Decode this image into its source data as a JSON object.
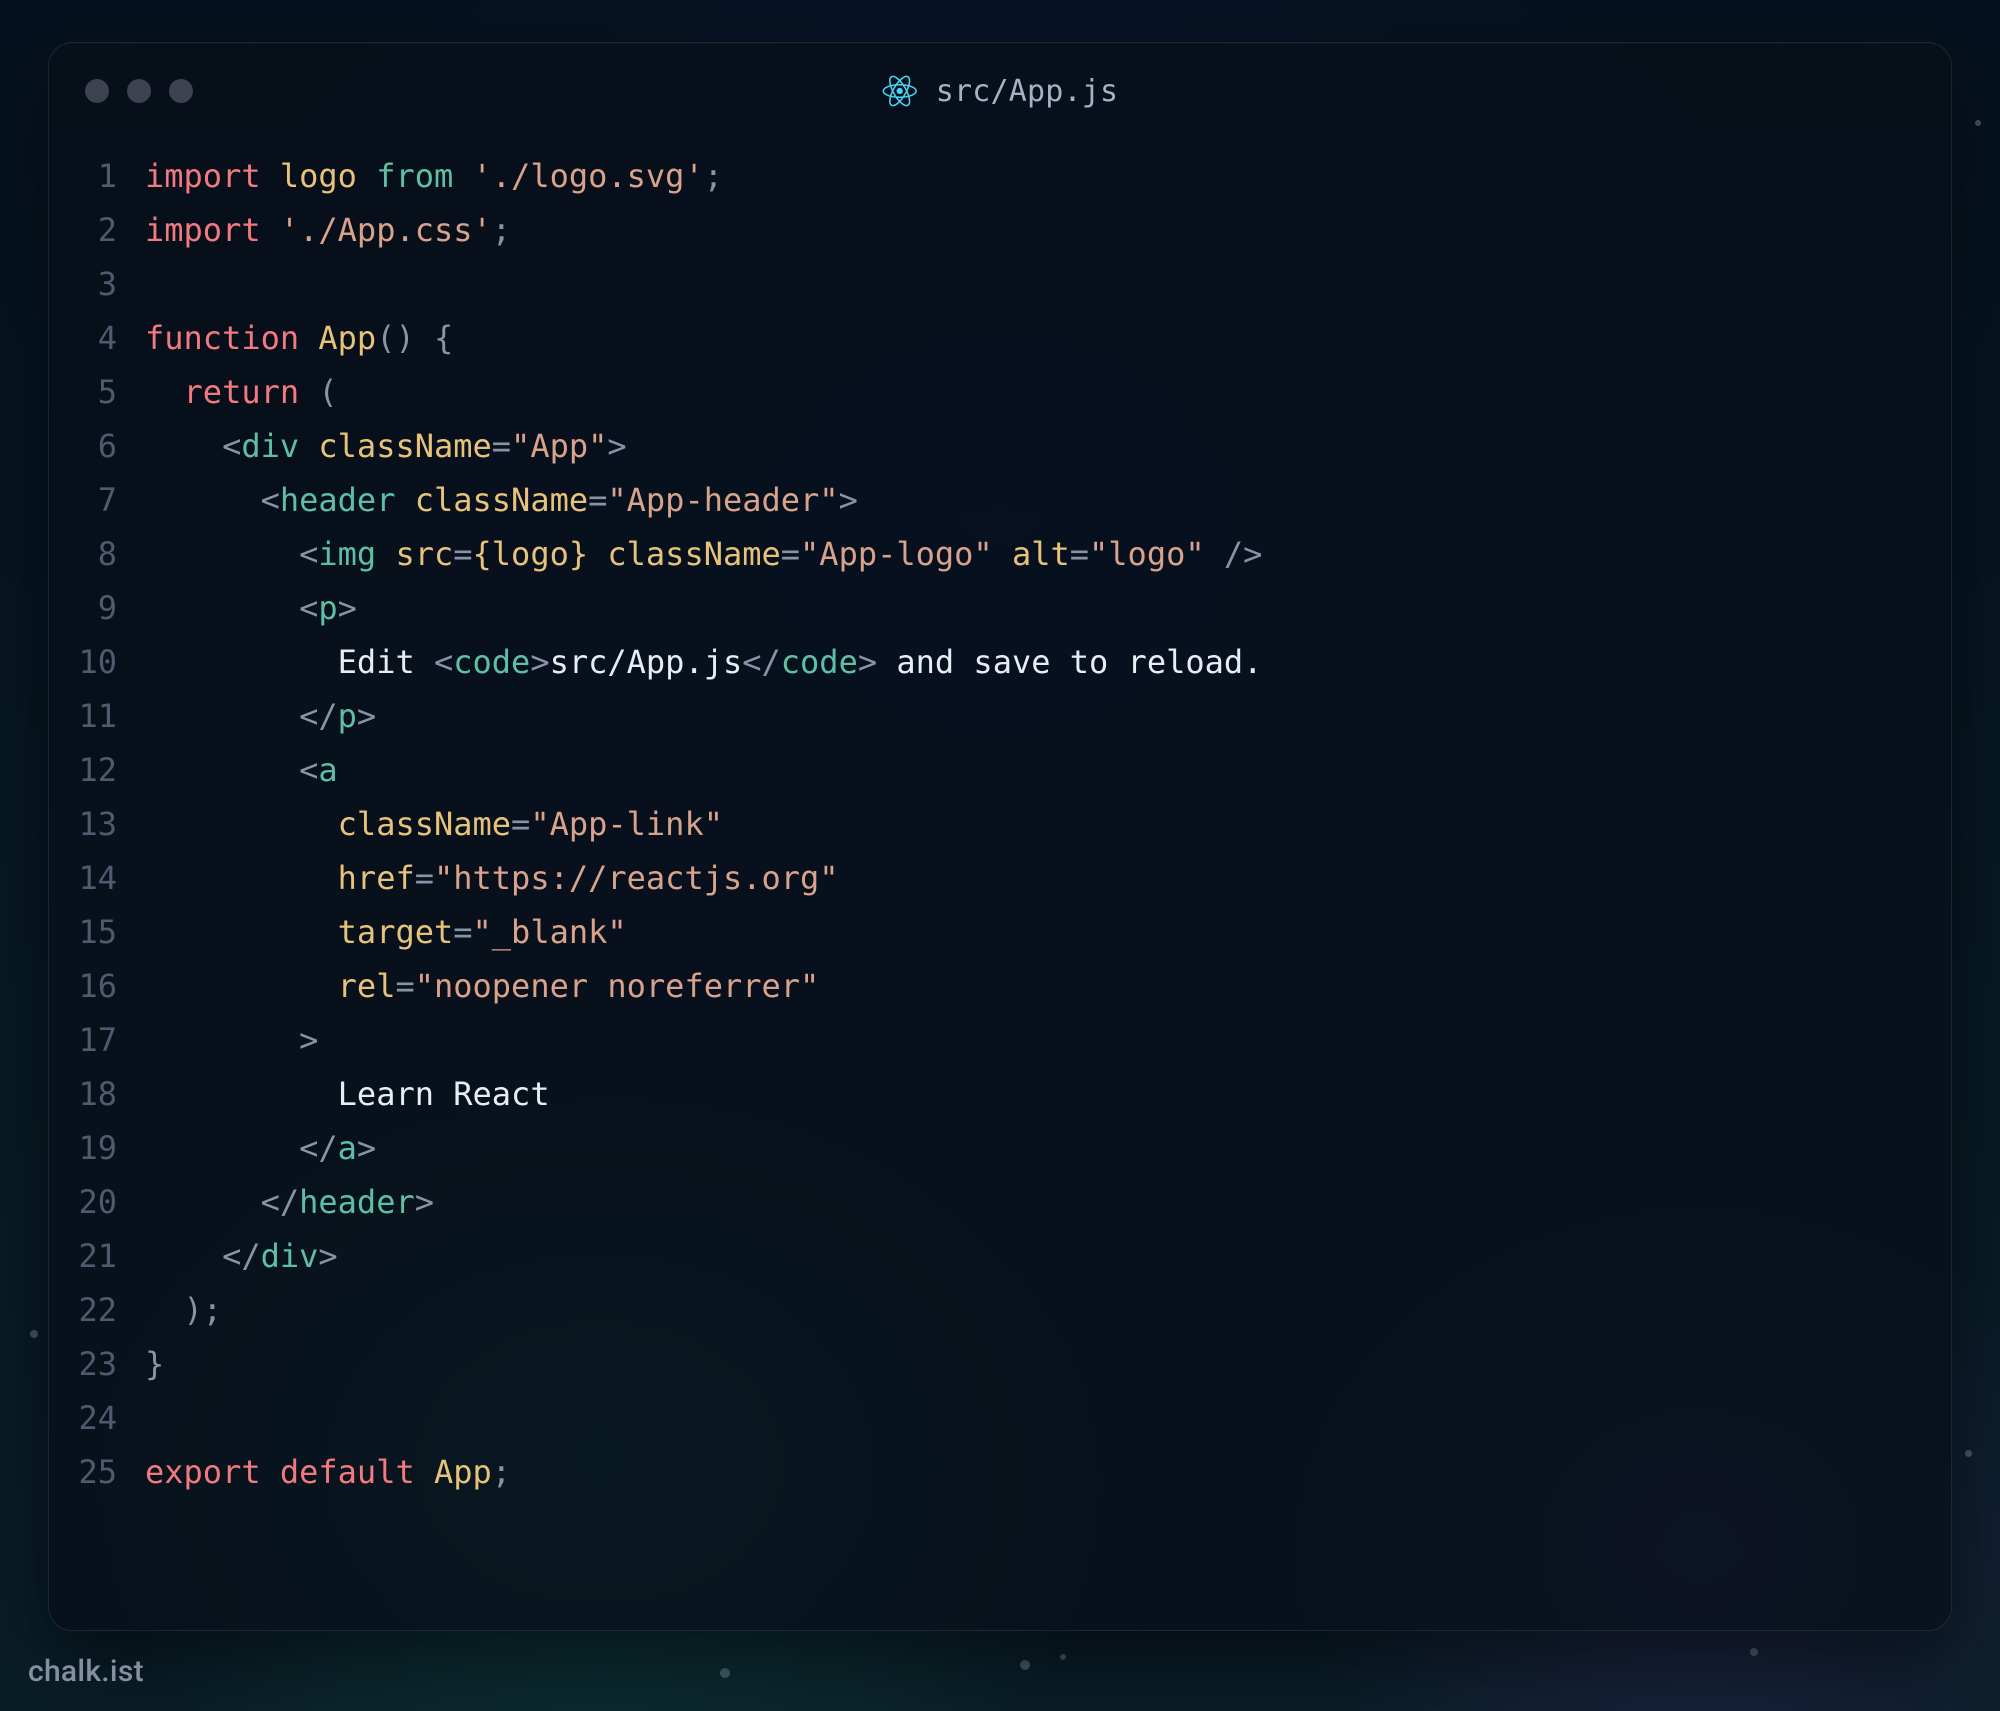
{
  "window": {
    "title": "src/App.js"
  },
  "watermark": "chalk.ist",
  "code": {
    "lines": [
      {
        "n": "1",
        "tokens": [
          [
            "kw",
            "import"
          ],
          [
            "txt",
            " "
          ],
          [
            "id",
            "logo"
          ],
          [
            "txt",
            " "
          ],
          [
            "from",
            "from"
          ],
          [
            "txt",
            " "
          ],
          [
            "str",
            "'./logo.svg'"
          ],
          [
            "pun",
            ";"
          ]
        ]
      },
      {
        "n": "2",
        "tokens": [
          [
            "kw",
            "import"
          ],
          [
            "txt",
            " "
          ],
          [
            "str",
            "'./App.css'"
          ],
          [
            "pun",
            ";"
          ]
        ]
      },
      {
        "n": "3",
        "tokens": []
      },
      {
        "n": "4",
        "tokens": [
          [
            "kw",
            "function"
          ],
          [
            "txt",
            " "
          ],
          [
            "id",
            "App"
          ],
          [
            "pun",
            "()"
          ],
          [
            "txt",
            " "
          ],
          [
            "pun",
            "{"
          ]
        ]
      },
      {
        "n": "5",
        "tokens": [
          [
            "txt",
            "  "
          ],
          [
            "kw",
            "return"
          ],
          [
            "txt",
            " "
          ],
          [
            "pun",
            "("
          ]
        ]
      },
      {
        "n": "6",
        "tokens": [
          [
            "txt",
            "    "
          ],
          [
            "tagp",
            "<"
          ],
          [
            "tagn",
            "div"
          ],
          [
            "txt",
            " "
          ],
          [
            "attr",
            "className"
          ],
          [
            "eq",
            "="
          ],
          [
            "str",
            "\"App\""
          ],
          [
            "tagp",
            ">"
          ]
        ]
      },
      {
        "n": "7",
        "tokens": [
          [
            "txt",
            "      "
          ],
          [
            "tagp",
            "<"
          ],
          [
            "tagn",
            "header"
          ],
          [
            "txt",
            " "
          ],
          [
            "attr",
            "className"
          ],
          [
            "eq",
            "="
          ],
          [
            "str",
            "\"App-header\""
          ],
          [
            "tagp",
            ">"
          ]
        ]
      },
      {
        "n": "8",
        "tokens": [
          [
            "txt",
            "        "
          ],
          [
            "tagp",
            "<"
          ],
          [
            "tagn",
            "img"
          ],
          [
            "txt",
            " "
          ],
          [
            "attr",
            "src"
          ],
          [
            "eq",
            "="
          ],
          [
            "brace",
            "{"
          ],
          [
            "id",
            "logo"
          ],
          [
            "brace",
            "}"
          ],
          [
            "txt",
            " "
          ],
          [
            "attr",
            "className"
          ],
          [
            "eq",
            "="
          ],
          [
            "str",
            "\"App-logo\""
          ],
          [
            "txt",
            " "
          ],
          [
            "attr",
            "alt"
          ],
          [
            "eq",
            "="
          ],
          [
            "str",
            "\"logo\""
          ],
          [
            "txt",
            " "
          ],
          [
            "tagp",
            "/>"
          ]
        ]
      },
      {
        "n": "9",
        "tokens": [
          [
            "txt",
            "        "
          ],
          [
            "tagp",
            "<"
          ],
          [
            "tagn",
            "p"
          ],
          [
            "tagp",
            ">"
          ]
        ]
      },
      {
        "n": "10",
        "tokens": [
          [
            "txt",
            "          "
          ],
          [
            "txt",
            "Edit "
          ],
          [
            "tagp",
            "<"
          ],
          [
            "tagn",
            "code"
          ],
          [
            "tagp",
            ">"
          ],
          [
            "txt",
            "src/App.js"
          ],
          [
            "tagp",
            "</"
          ],
          [
            "tagn",
            "code"
          ],
          [
            "tagp",
            ">"
          ],
          [
            "txt",
            " and save to reload."
          ]
        ]
      },
      {
        "n": "11",
        "tokens": [
          [
            "txt",
            "        "
          ],
          [
            "tagp",
            "</"
          ],
          [
            "tagn",
            "p"
          ],
          [
            "tagp",
            ">"
          ]
        ]
      },
      {
        "n": "12",
        "tokens": [
          [
            "txt",
            "        "
          ],
          [
            "tagp",
            "<"
          ],
          [
            "tagn",
            "a"
          ]
        ]
      },
      {
        "n": "13",
        "tokens": [
          [
            "txt",
            "          "
          ],
          [
            "attr",
            "className"
          ],
          [
            "eq",
            "="
          ],
          [
            "str",
            "\"App-link\""
          ]
        ]
      },
      {
        "n": "14",
        "tokens": [
          [
            "txt",
            "          "
          ],
          [
            "attr",
            "href"
          ],
          [
            "eq",
            "="
          ],
          [
            "str",
            "\"https://reactjs.org\""
          ]
        ]
      },
      {
        "n": "15",
        "tokens": [
          [
            "txt",
            "          "
          ],
          [
            "attr",
            "target"
          ],
          [
            "eq",
            "="
          ],
          [
            "str",
            "\"_blank\""
          ]
        ]
      },
      {
        "n": "16",
        "tokens": [
          [
            "txt",
            "          "
          ],
          [
            "attr",
            "rel"
          ],
          [
            "eq",
            "="
          ],
          [
            "str",
            "\"noopener noreferrer\""
          ]
        ]
      },
      {
        "n": "17",
        "tokens": [
          [
            "txt",
            "        "
          ],
          [
            "tagp",
            ">"
          ]
        ]
      },
      {
        "n": "18",
        "tokens": [
          [
            "txt",
            "          "
          ],
          [
            "txt",
            "Learn React"
          ]
        ]
      },
      {
        "n": "19",
        "tokens": [
          [
            "txt",
            "        "
          ],
          [
            "tagp",
            "</"
          ],
          [
            "tagn",
            "a"
          ],
          [
            "tagp",
            ">"
          ]
        ]
      },
      {
        "n": "20",
        "tokens": [
          [
            "txt",
            "      "
          ],
          [
            "tagp",
            "</"
          ],
          [
            "tagn",
            "header"
          ],
          [
            "tagp",
            ">"
          ]
        ]
      },
      {
        "n": "21",
        "tokens": [
          [
            "txt",
            "    "
          ],
          [
            "tagp",
            "</"
          ],
          [
            "tagn",
            "div"
          ],
          [
            "tagp",
            ">"
          ]
        ]
      },
      {
        "n": "22",
        "tokens": [
          [
            "txt",
            "  "
          ],
          [
            "pun",
            ");"
          ]
        ]
      },
      {
        "n": "23",
        "tokens": [
          [
            "pun",
            "}"
          ]
        ]
      },
      {
        "n": "24",
        "tokens": []
      },
      {
        "n": "25",
        "tokens": [
          [
            "kw",
            "export"
          ],
          [
            "txt",
            " "
          ],
          [
            "kw",
            "default"
          ],
          [
            "txt",
            " "
          ],
          [
            "id",
            "App"
          ],
          [
            "pun",
            ";"
          ]
        ]
      }
    ]
  }
}
